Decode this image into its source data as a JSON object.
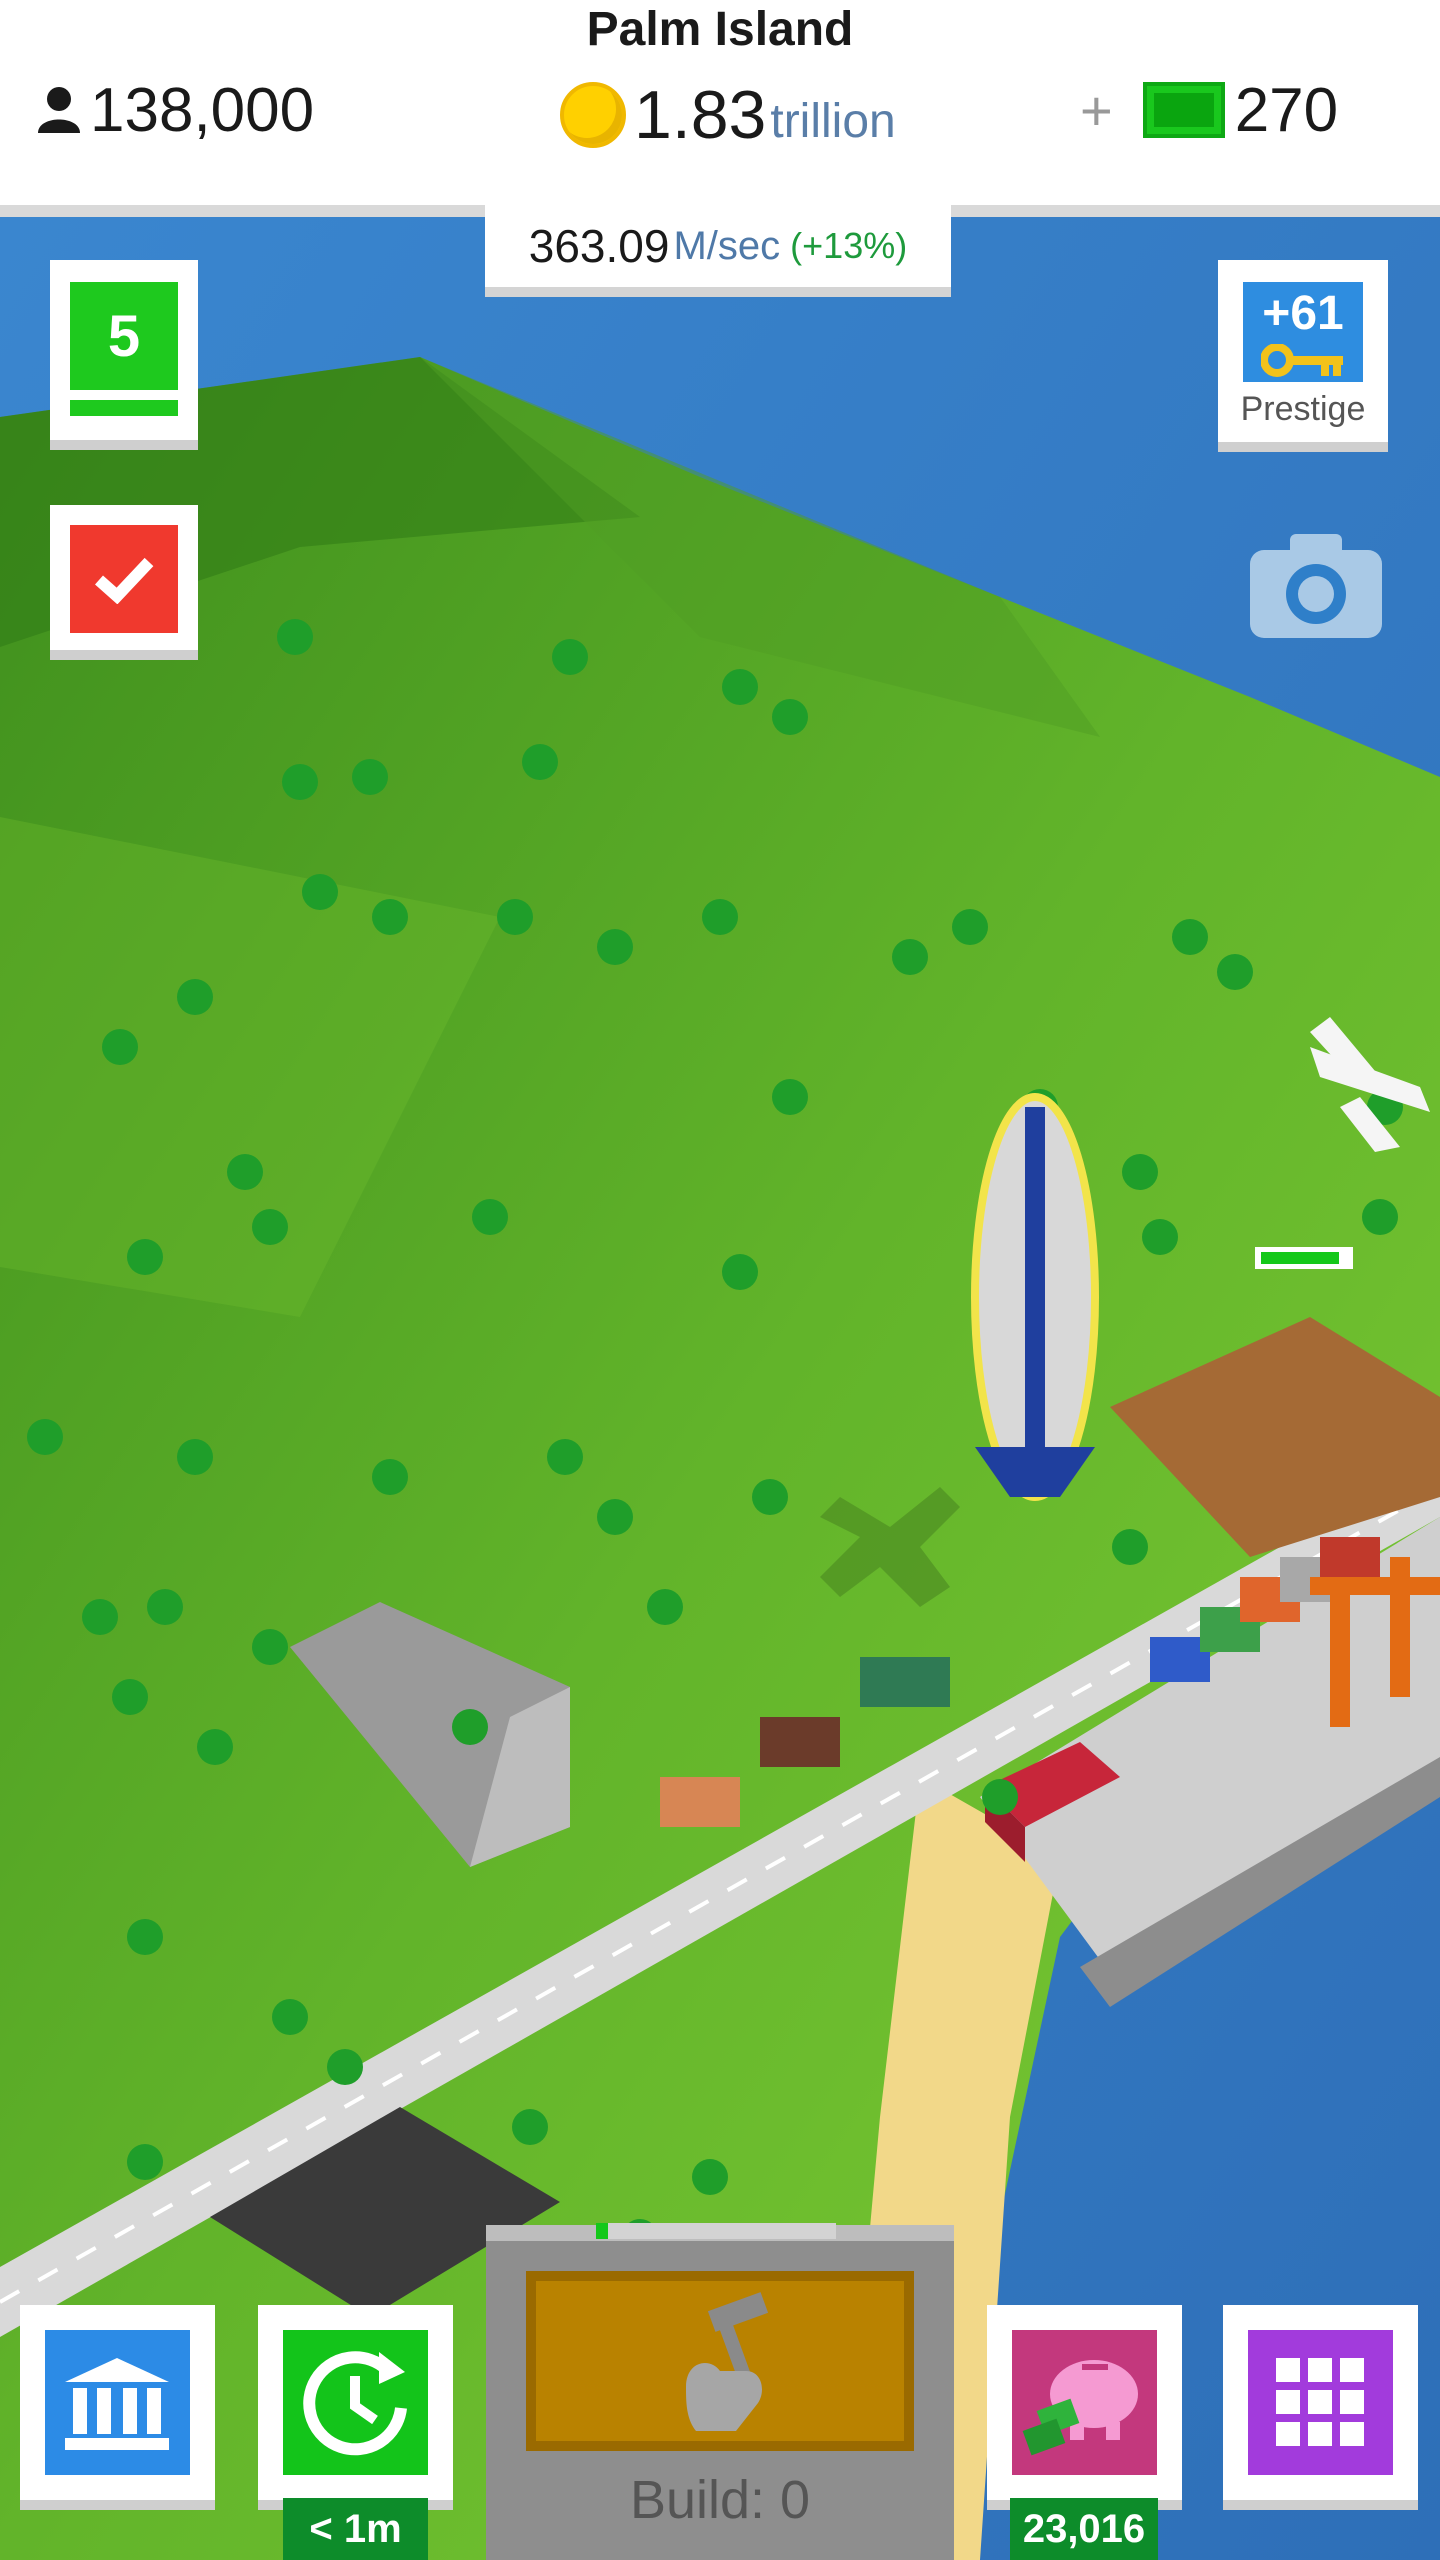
{
  "header": {
    "island_name": "Palm Island",
    "population": "138,000",
    "coins_value": "1.83",
    "coins_unit": "trillion",
    "plus_label": "+",
    "cash_value": "270"
  },
  "income": {
    "rate_value": "363.09",
    "rate_unit": "M/sec",
    "rate_bonus": "(+13%)"
  },
  "level_button": {
    "level": "5",
    "progress": 1.0
  },
  "prestige": {
    "amount": "+61",
    "label": "Prestige"
  },
  "bottom_bar": {
    "speed_timer": "< 1m",
    "build_label": "Build: 0",
    "build_progress": 0.05,
    "piggy_bank_amount": "23,016"
  },
  "icons": {
    "population": "person-icon",
    "coins": "coin-icon",
    "cash": "cash-bill-icon",
    "task": "checkmark-icon",
    "prestige": "key-icon",
    "camera": "camera-icon",
    "bank": "bank-icon",
    "speed": "clock-refresh-icon",
    "build": "hammer-hand-icon",
    "piggy": "piggy-bank-icon",
    "menu": "grid-icon"
  },
  "colors": {
    "level_green": "#1ec91e",
    "task_red": "#f0392e",
    "prestige_blue": "#2e8de0",
    "bank_blue": "#2c8be6",
    "speed_green": "#13c41a",
    "build_gold": "#b98200",
    "piggy_pink": "#c3387d",
    "menu_purple": "#a23bdc",
    "badge_green": "#0d8c2a"
  }
}
